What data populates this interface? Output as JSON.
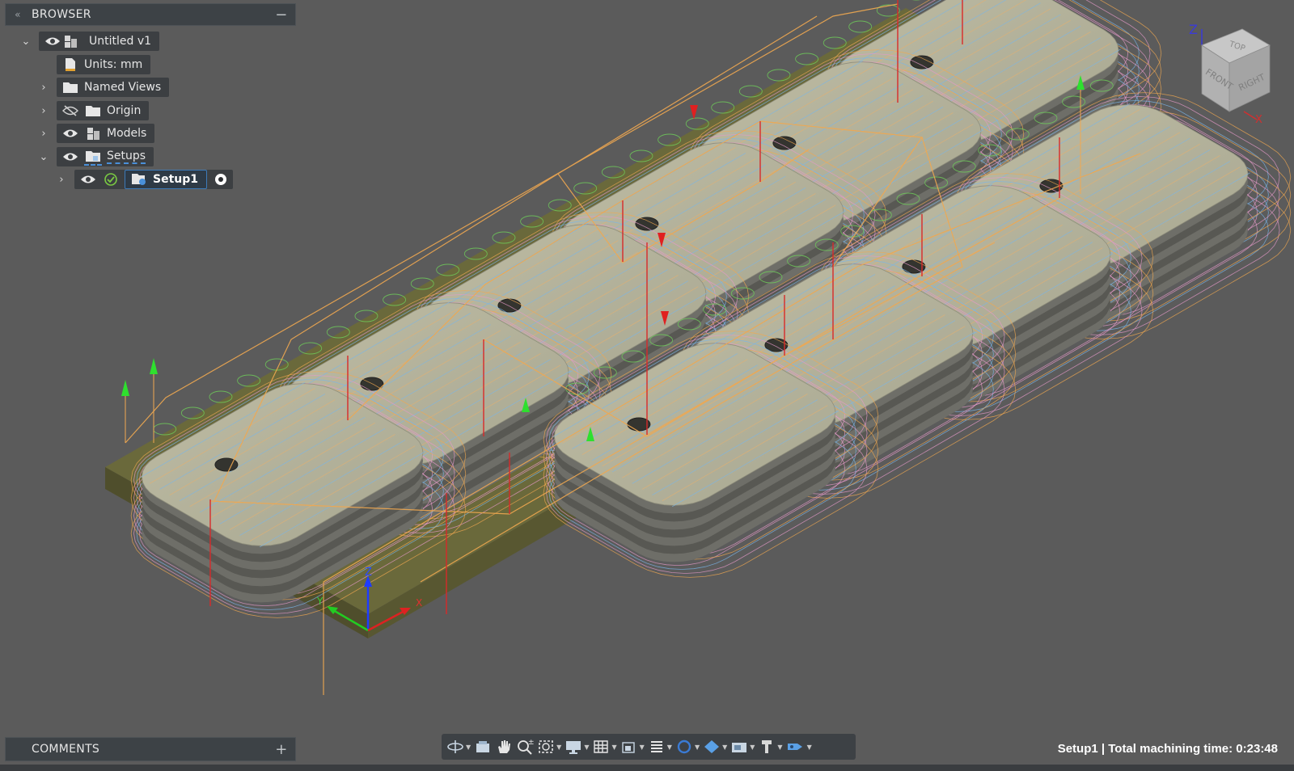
{
  "browser": {
    "title": "BROWSER",
    "collapse_glyph": "«",
    "action_glyph": "−",
    "tree": [
      {
        "id": "root",
        "label": "Untitled v1",
        "expanded": true,
        "icon": "component-icon"
      },
      {
        "id": "units",
        "label": "Units: mm",
        "icon": "document-icon"
      },
      {
        "id": "named_views",
        "label": "Named Views",
        "icon": "folder-icon",
        "expanded": false
      },
      {
        "id": "origin",
        "label": "Origin",
        "icon": "folder-icon",
        "expanded": false,
        "hidden": true
      },
      {
        "id": "models",
        "label": "Models",
        "icon": "component-icon",
        "expanded": false
      },
      {
        "id": "setups",
        "label": "Setups",
        "icon": "setups-folder-icon",
        "expanded": true
      },
      {
        "id": "setup1",
        "label": "Setup1",
        "icon": "setup-icon",
        "expanded": false,
        "selected": true,
        "status": "ok"
      }
    ]
  },
  "comments": {
    "title": "COMMENTS",
    "add_glyph": "+"
  },
  "toolbar": {
    "buttons": [
      {
        "name": "orbit-icon",
        "caret": true
      },
      {
        "name": "look-at-icon",
        "caret": false
      },
      {
        "name": "pan-hand-icon",
        "caret": false
      },
      {
        "name": "zoom-icon",
        "caret": false
      },
      {
        "name": "fit-icon",
        "caret": true
      },
      {
        "name": "display-settings-icon",
        "caret": true
      },
      {
        "name": "grid-icon",
        "caret": true
      },
      {
        "name": "viewports-icon",
        "caret": true
      },
      {
        "name": "effects-icon",
        "caret": true
      },
      {
        "name": "simulation-icon",
        "caret": true
      },
      {
        "name": "stock-icon",
        "caret": true
      },
      {
        "name": "camera-icon",
        "caret": true
      },
      {
        "name": "tool-icon",
        "caret": true
      },
      {
        "name": "machine-icon",
        "caret": true
      }
    ]
  },
  "status": {
    "text": "Setup1 | Total machining time: 0:23:48"
  },
  "viewcube": {
    "top": "TOP",
    "front": "FRONT",
    "right": "RIGHT",
    "axis_z": "Z",
    "axis_x": "X"
  },
  "triad": {
    "x": "X",
    "y": "Y",
    "z": "Z"
  },
  "colors": {
    "background": "#5b5b5b",
    "panel": "#3d4246",
    "selection": "#3d7ab8",
    "stock": "#6b6a3a",
    "part": "#b2b09a",
    "toolpath_orange": "#f0a850",
    "toolpath_blue": "#7ab6e8",
    "toolpath_pink": "#e49ac8",
    "toolpath_green": "#6fcf5a",
    "plunge_red": "#e02020",
    "retract_green": "#2ee02e"
  }
}
